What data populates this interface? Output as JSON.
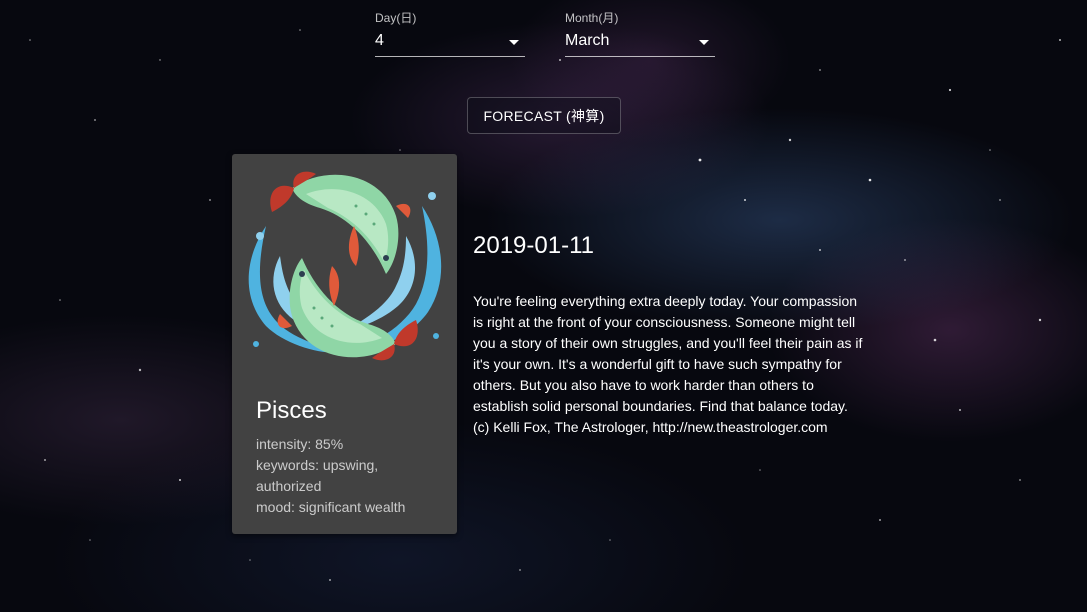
{
  "day_select": {
    "label": "Day(日)",
    "value": "4"
  },
  "month_select": {
    "label": "Month(月)",
    "value": "March"
  },
  "forecast_button": {
    "label": "FORECAST (神算)"
  },
  "sign_card": {
    "icon": "pisces-fish-icon",
    "name": "Pisces",
    "intensity": "intensity: 85%",
    "keywords": "keywords: upswing, authorized",
    "mood": "mood: significant wealth"
  },
  "horoscope": {
    "date": "2019-01-11",
    "text": "You're feeling everything extra deeply today. Your compassion is right at the front of your consciousness. Someone might tell you a story of their own struggles, and you'll feel their pain as if it's your own. It's a wonderful gift to have such sympathy for others. But you also have to work harder than others to establish solid personal boundaries. Find that balance today.(c) Kelli Fox, The Astrologer, http://new.theastrologer.com"
  },
  "colors": {
    "background": "#07080f",
    "card": "#424242",
    "fish_green": "#8fd6a6",
    "fish_fin": "#c0392b",
    "water_blue": "#4fb3e0"
  }
}
